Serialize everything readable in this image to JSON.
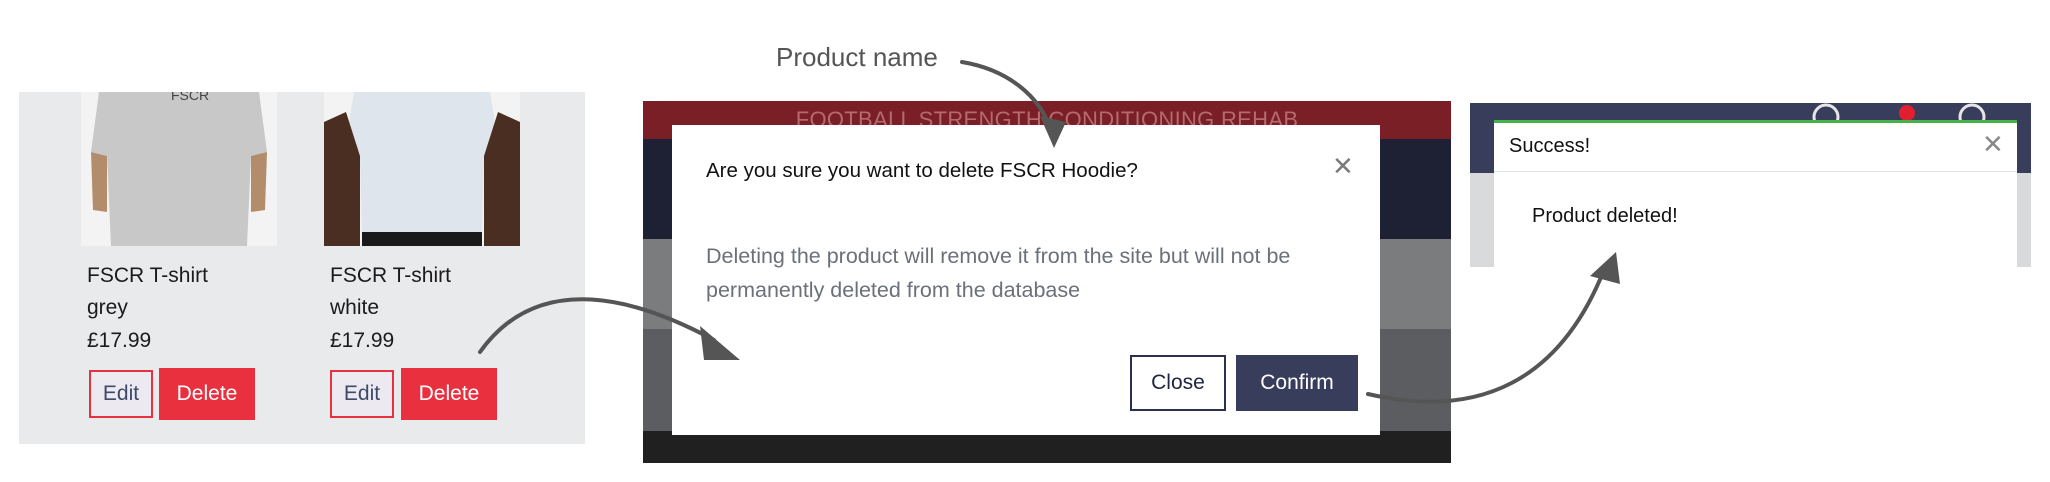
{
  "annotation": {
    "label": "Product name"
  },
  "products": [
    {
      "name": "FSCR T-shirt",
      "color": "grey",
      "price": "£17.99",
      "edit_label": "Edit",
      "delete_label": "Delete"
    },
    {
      "name": "FSCR T-shirt",
      "color": "white",
      "price": "£17.99",
      "edit_label": "Edit",
      "delete_label": "Delete"
    }
  ],
  "modal": {
    "background_banner": "FOOTBALL STRENGTH CONDITIONING REHAB",
    "title": "Are you sure you want to delete FSCR Hoodie?",
    "body": "Deleting the product will remove it from the site but will not be permanently deleted from the database",
    "close_label": "Close",
    "confirm_label": "Confirm",
    "close_icon": "close-icon"
  },
  "toast": {
    "title": "Success!",
    "message": "Product deleted!",
    "close_icon": "close-icon",
    "accent": "#48b24a"
  },
  "colors": {
    "danger": "#e9303f",
    "navy": "#393d5c"
  }
}
